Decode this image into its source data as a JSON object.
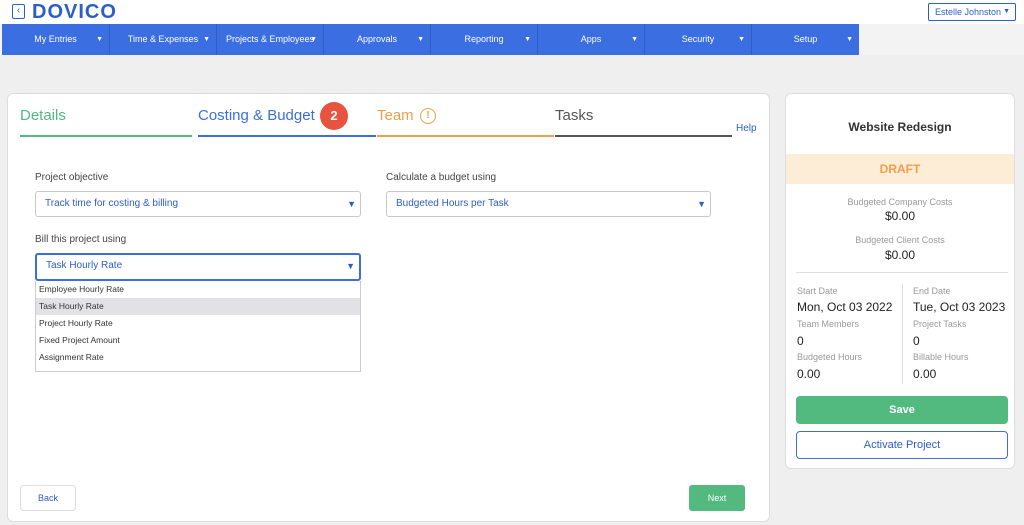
{
  "header": {
    "back_icon": "chevron-left-icon",
    "logo": "DOVICO",
    "user_name": "Estelle Johnston"
  },
  "nav": {
    "items": [
      {
        "label": "My Entries"
      },
      {
        "label": "Time & Expenses"
      },
      {
        "label": "Projects & Employees"
      },
      {
        "label": "Approvals"
      },
      {
        "label": "Reporting"
      },
      {
        "label": "Apps"
      },
      {
        "label": "Security"
      },
      {
        "label": "Setup"
      }
    ]
  },
  "tabs": {
    "details": "Details",
    "costing": "Costing & Budget",
    "costing_step": "2",
    "team": "Team",
    "team_warning": "!",
    "tasks": "Tasks",
    "help": "Help"
  },
  "form": {
    "objective_label": "Project objective",
    "objective_value": "Track time for costing & billing",
    "budget_label": "Calculate a budget using",
    "budget_value": "Budgeted Hours per Task",
    "bill_label": "Bill this project using",
    "bill_value": "Task Hourly Rate",
    "bill_options": [
      {
        "label": "Employee Hourly Rate"
      },
      {
        "label": "Task Hourly Rate"
      },
      {
        "label": "Project Hourly Rate"
      },
      {
        "label": "Fixed Project Amount"
      },
      {
        "label": "Assignment Rate"
      }
    ]
  },
  "footer": {
    "back": "Back",
    "next": "Next"
  },
  "summary": {
    "title": "Website Redesign",
    "status": "DRAFT",
    "company_costs_label": "Budgeted Company Costs",
    "company_costs": "$0.00",
    "client_costs_label": "Budgeted Client Costs",
    "client_costs": "$0.00",
    "start_label": "Start Date",
    "start": "Mon, Oct 03 2022",
    "end_label": "End Date",
    "end": "Tue, Oct 03 2023",
    "members_label": "Team Members",
    "members": "0",
    "tasks_label": "Project Tasks",
    "tasks": "0",
    "budgeted_hours_label": "Budgeted Hours",
    "budgeted_hours": "0.00",
    "billable_hours_label": "Billable Hours",
    "billable_hours": "0.00",
    "save": "Save",
    "activate": "Activate Project"
  },
  "colors": {
    "brand": "#2c5ec9",
    "nav": "#3b6ee0",
    "details_tab": "#52b97f",
    "costing_tab": "#3b6ee0",
    "team_tab": "#f0a04a",
    "tasks_tab": "#555555",
    "step_badge": "#e6543f",
    "draft_bg": "#fdecd6"
  }
}
